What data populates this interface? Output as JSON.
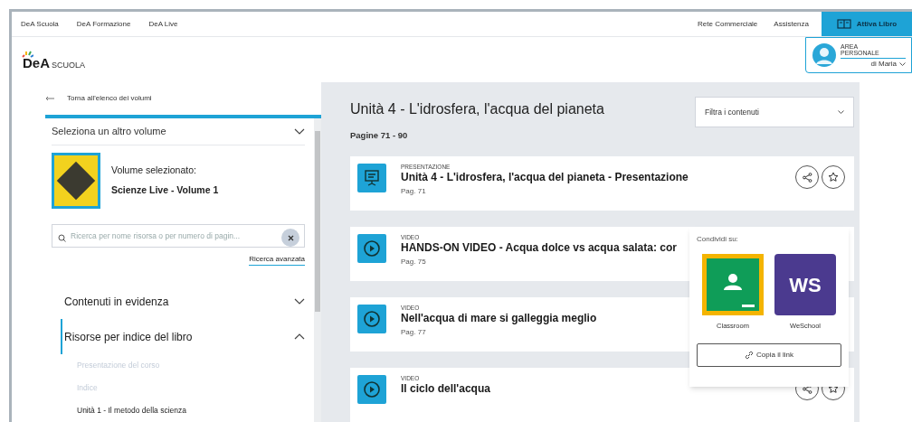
{
  "top_bar": {
    "links": [
      "DeA Scuola",
      "DeA Formazione",
      "DeA Live"
    ],
    "right_links": [
      "Rete Commerciale",
      "Assistenza"
    ],
    "activate_button": "Attiva Libro"
  },
  "header": {
    "logo": {
      "brand": "DeA",
      "sub": "SCUOLA"
    },
    "personal_area": {
      "line_1": "AREA",
      "line_2": "PERSONALE",
      "user": "di Maria"
    }
  },
  "sidebar": {
    "back_link": "Torna all'elenco dei volumi",
    "volume_select": {
      "label": "Seleziona un altro volume",
      "expanded": false
    },
    "selected_volume": {
      "label": "Volume selezionato:",
      "name": "Scienze Live - Volume 1"
    },
    "search": {
      "placeholder": "Ricerca per nome risorsa o per numero di pagin..."
    },
    "advanced_search": "Ricerca avanzata",
    "sections": [
      {
        "label": "Contenuti in evidenza",
        "expanded": false
      },
      {
        "label": "Risorse per indice del libro",
        "expanded": true,
        "children": [
          {
            "label": "Presentazione del corso",
            "disabled": true
          },
          {
            "label": "Indice",
            "disabled": true
          },
          {
            "label": "Unità 1 - Il metodo della scienza",
            "disabled": false
          }
        ]
      }
    ]
  },
  "main": {
    "title": "Unità 4 - L'idrosfera, l'acqua del pianeta",
    "pages": "Pagine 71 - 90",
    "filter": "Filtra i contenuti",
    "resources": [
      {
        "kind": "presentation",
        "type_label": "PRESENTAZIONE",
        "title": "Unità 4 - L'idrosfera, l'acqua del pianeta - Presentazione",
        "page": "Pag. 71"
      },
      {
        "kind": "video",
        "type_label": "VIDEO",
        "title": "HANDS-ON VIDEO - Acqua dolce vs acqua salata: cor",
        "page": "Pag. 75"
      },
      {
        "kind": "video",
        "type_label": "VIDEO",
        "title": "Nell'acqua di mare si galleggia meglio",
        "page": "Pag. 77"
      },
      {
        "kind": "video",
        "type_label": "VIDEO",
        "title": "Il ciclo dell'acqua"
      }
    ],
    "share_popup": {
      "title": "Condividi su:",
      "targets": [
        {
          "kind": "classroom",
          "label": "Classroom"
        },
        {
          "kind": "weschool",
          "label": "WeSchool",
          "logo_text": "WS"
        }
      ],
      "copy_link": "Copia il link"
    }
  }
}
